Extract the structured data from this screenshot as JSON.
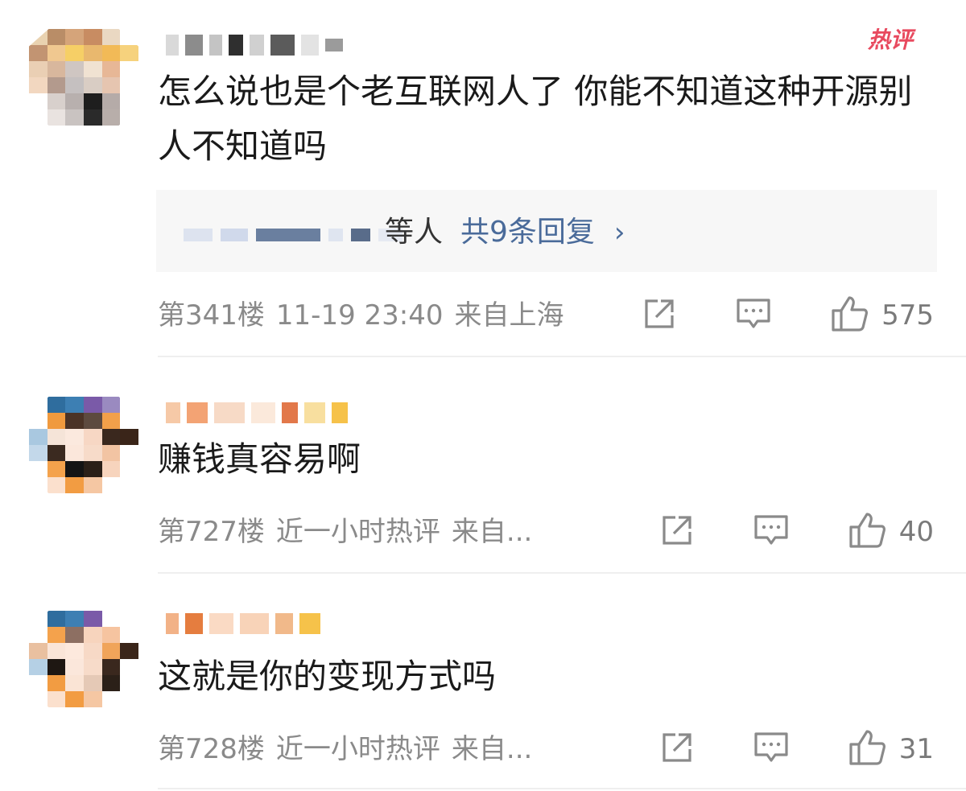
{
  "comments": [
    {
      "badge": "热评",
      "content": "怎么说也是个老互联网人了  你能不知道这种开源别人不知道吗",
      "reply": {
        "prefix": "等人",
        "link": "共9条回复",
        "chevron": "›"
      },
      "floor": "第341楼",
      "time": "11-19 23:40",
      "location": "来自上海",
      "likes": "575"
    },
    {
      "content": "赚钱真容易啊",
      "floor": "第727楼",
      "time": "近一小时热评",
      "location": "来自...",
      "likes": "40"
    },
    {
      "content": "这就是你的变现方式吗",
      "floor": "第728楼",
      "time": "近一小时热评",
      "location": "来自...",
      "likes": "31"
    }
  ],
  "icons": {
    "share": "share-icon",
    "reply": "comment-icon",
    "like": "thumbs-up-icon"
  },
  "colors": {
    "link": "#4a6b9a",
    "meta": "#8a8a8a",
    "hot_badge": "#e84a5f",
    "reply_bg": "#f7f7f7"
  }
}
